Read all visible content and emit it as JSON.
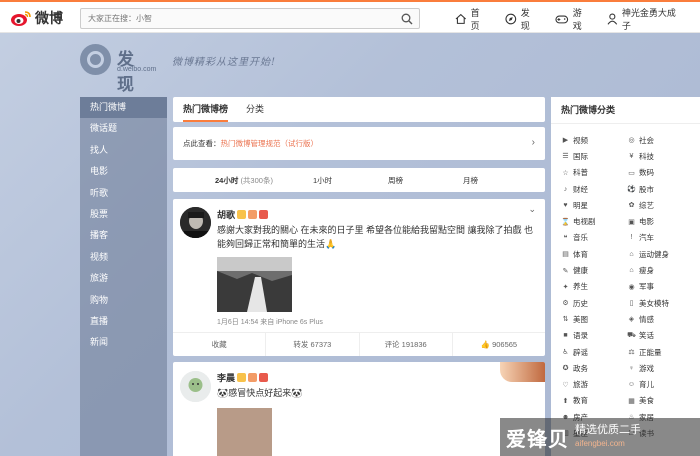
{
  "brand": {
    "logo_text": "微博"
  },
  "search": {
    "placeholder": "大家正在搜：小智",
    "icon": "search-icon"
  },
  "nav": [
    {
      "label": "首页",
      "icon": "home-icon"
    },
    {
      "label": "发现",
      "icon": "compass-icon"
    },
    {
      "label": "游戏",
      "icon": "gamepad-icon"
    },
    {
      "label": "神光金勇大成子",
      "icon": "user-icon"
    }
  ],
  "discover": {
    "title": "发现",
    "domain": "d.weibo.com",
    "slogan": "微博精彩从这里开始!"
  },
  "left_menu": [
    "热门微博",
    "微话题",
    "找人",
    "电影",
    "听歌",
    "股票",
    "播客",
    "视频",
    "旅游",
    "购物",
    "直播",
    "新闻"
  ],
  "main": {
    "tabs": [
      "热门微博榜",
      "分类"
    ],
    "notice": {
      "prefix": "点此查看：",
      "link": "热门微博管理规范（试行版）"
    },
    "time_tabs": {
      "t24": "24小时",
      "t24_count": "(共300条)",
      "t1": "1小时",
      "week": "周榜",
      "month": "月榜"
    }
  },
  "feed": [
    {
      "user": "胡歌",
      "text": "感謝大家對我的關心 在未來的日子里 希望各位能給我留點空間 讓我除了拍戲 也能夠回歸正常和簡單的生活🙏",
      "meta": "1月6日 14:54 来自 iPhone 6s Plus",
      "actions": {
        "fav": "收藏",
        "repost": "转发 67373",
        "comment": "评论 191836",
        "like": "906565"
      }
    },
    {
      "user": "李晨",
      "text": "🐼感冒快点好起来🐼"
    }
  ],
  "right": {
    "title": "热门微博分类",
    "categories": [
      [
        "视频",
        "社会"
      ],
      [
        "国际",
        "科技"
      ],
      [
        "科普",
        "数码"
      ],
      [
        "财经",
        "股市"
      ],
      [
        "明星",
        "综艺"
      ],
      [
        "电视剧",
        "电影"
      ],
      [
        "音乐",
        "汽车"
      ],
      [
        "体育",
        "运动健身"
      ],
      [
        "健康",
        "瘦身"
      ],
      [
        "养生",
        "军事"
      ],
      [
        "历史",
        "美女模特"
      ],
      [
        "美图",
        "情感"
      ],
      [
        "语录",
        "笑话"
      ],
      [
        "辟谣",
        "正能量"
      ],
      [
        "政务",
        "游戏"
      ],
      [
        "旅游",
        "育儿"
      ],
      [
        "教育",
        "美食"
      ],
      [
        "房产",
        "家居"
      ],
      [
        "星座",
        "读书"
      ]
    ]
  },
  "watermark": {
    "main": "爱锋贝",
    "sub1": "精选优质二手",
    "sub2": "aifengbei.com"
  },
  "colors": {
    "accent": "#fa7d3c",
    "link": "#eb7350",
    "menu_bg": "#6d7d99"
  }
}
